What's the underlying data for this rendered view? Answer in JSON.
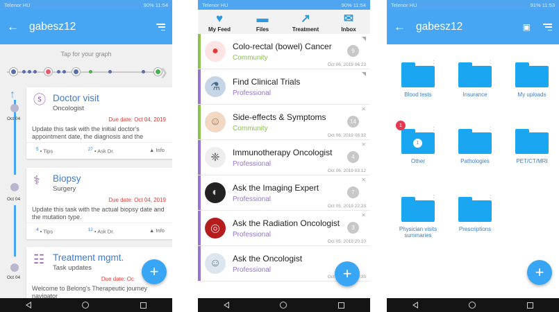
{
  "status": {
    "carrier": "Telenor HU",
    "p1": {
      "right": "90%",
      "time": "11:54"
    },
    "p2": {
      "right": "90%",
      "time": "11:54"
    },
    "p3": {
      "right": "91%",
      "time": "11:53"
    }
  },
  "colors": {
    "accent": "#46a6f3",
    "due": "#e53935",
    "community": "#8bc34a",
    "professional": "#9575cd",
    "folder": "#1aa6f0"
  },
  "screen1": {
    "title": "gabesz12",
    "graph_hint": "Tap for your graph",
    "tasks": [
      {
        "icon": "stethoscope-icon",
        "name": "Doctor visit",
        "sub": "Oncologist",
        "due": "Due date:  Oct 04, 2019",
        "desc": "Update this task with the initial doctor's appointment date, the diagnosis and the",
        "tips": "5",
        "tips_label": "Tips",
        "ask": "27",
        "ask_label": "Ask Dr.",
        "info": "Info",
        "date": "Oct 04"
      },
      {
        "icon": "microscope-icon",
        "name": "Biopsy",
        "sub": "Surgery",
        "due": "Due date:  Oct 04, 2019",
        "desc": "Update this task with the actual biopsy date and the mutation type.",
        "tips": "4",
        "tips_label": "Tips",
        "ask": "12",
        "ask_label": "Ask Dr.",
        "info": "Info",
        "date": "Oct 04"
      },
      {
        "icon": "clipboard-icon",
        "name": "Treatment mgmt.",
        "sub": "Task updates",
        "due": "Due date:  Oc",
        "desc": "Welcome to Belong's Therapeutic journey navigator",
        "date": "Oct 04"
      }
    ]
  },
  "screen2": {
    "tabs": [
      {
        "label": "My Feed"
      },
      {
        "label": "Files"
      },
      {
        "label": "Treatment"
      },
      {
        "label": "Inbox"
      }
    ],
    "feed": [
      {
        "title": "Colo-rectal (bowel) Cancer",
        "type": "Community",
        "count": "9",
        "ts": "Oct 06, 2019 06:22",
        "pin": true
      },
      {
        "title": "Find Clinical Trials",
        "type": "Professional",
        "count": "",
        "ts": "",
        "pin": true
      },
      {
        "title": "Side-effects & Symptoms",
        "type": "Community",
        "count": "14",
        "ts": "Oct 06, 2019 08:32",
        "pin": false
      },
      {
        "title": "Immunotherapy Oncologist",
        "type": "Professional",
        "count": "4",
        "ts": "Oct 06, 2019 03:12",
        "pin": false
      },
      {
        "title": "Ask the Imaging Expert",
        "type": "Professional",
        "count": "7",
        "ts": "Oct 05, 2019 22:23",
        "pin": false
      },
      {
        "title": "Ask the Radiation Oncologist",
        "type": "Professional",
        "count": "3",
        "ts": "Oct 05, 2019 20:10",
        "pin": false
      },
      {
        "title": "Ask the Oncologist",
        "type": "Professional",
        "count": "",
        "ts": "Oct 05, 2019 19:35",
        "pin": false
      }
    ]
  },
  "screen3": {
    "title": "gabesz12",
    "folders": [
      {
        "label": "Blood tests"
      },
      {
        "label": "Insurance"
      },
      {
        "label": "My uploads"
      },
      {
        "label": "Other",
        "badge": "1",
        "inner": "1"
      },
      {
        "label": "Pathologies"
      },
      {
        "label": "PET/CT/MRI"
      },
      {
        "label": "Physician visits summaries"
      },
      {
        "label": "Prescriptions"
      }
    ]
  },
  "fab_label": "+"
}
